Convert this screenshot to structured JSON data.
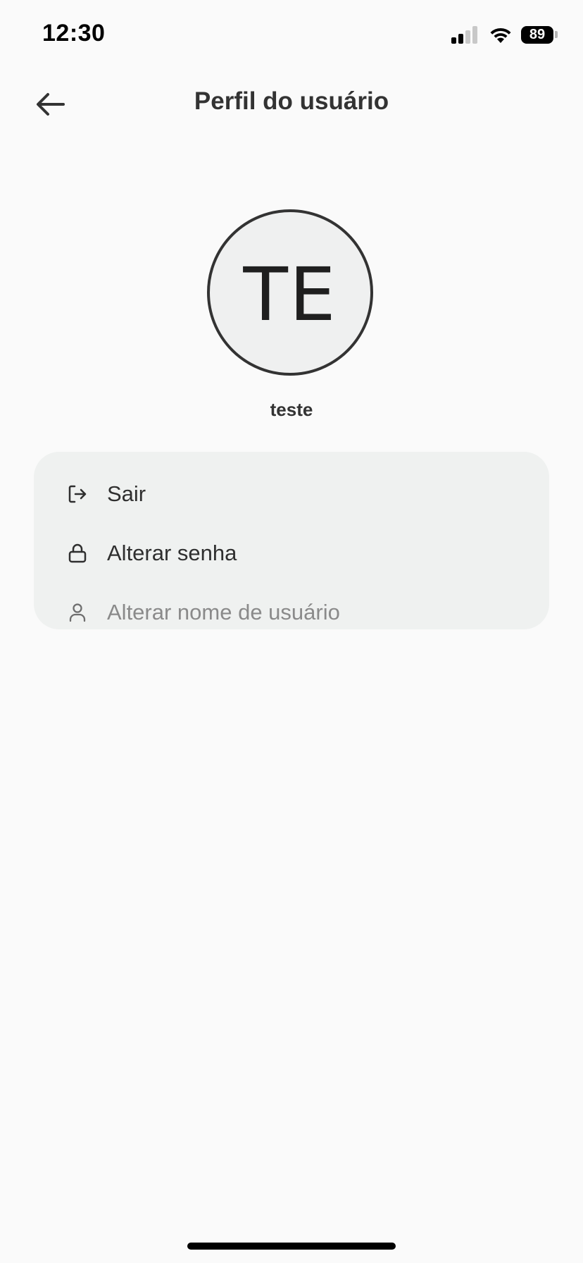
{
  "status_bar": {
    "time": "12:30",
    "battery_level": "89"
  },
  "header": {
    "title": "Perfil do usuário",
    "back_icon": "arrow-left-icon"
  },
  "profile": {
    "initials": "TE",
    "username": "teste"
  },
  "menu": {
    "items": [
      {
        "label": "Sair",
        "icon": "logout-icon",
        "enabled": true
      },
      {
        "label": "Alterar senha",
        "icon": "lock-icon",
        "enabled": true
      },
      {
        "label": "Alterar nome de usuário",
        "icon": "user-icon",
        "enabled": false
      }
    ]
  },
  "colors": {
    "background": "#fafafa",
    "card": "#eff1f0",
    "text": "#2f2f2f",
    "disabled_text": "#8a8a8a"
  }
}
